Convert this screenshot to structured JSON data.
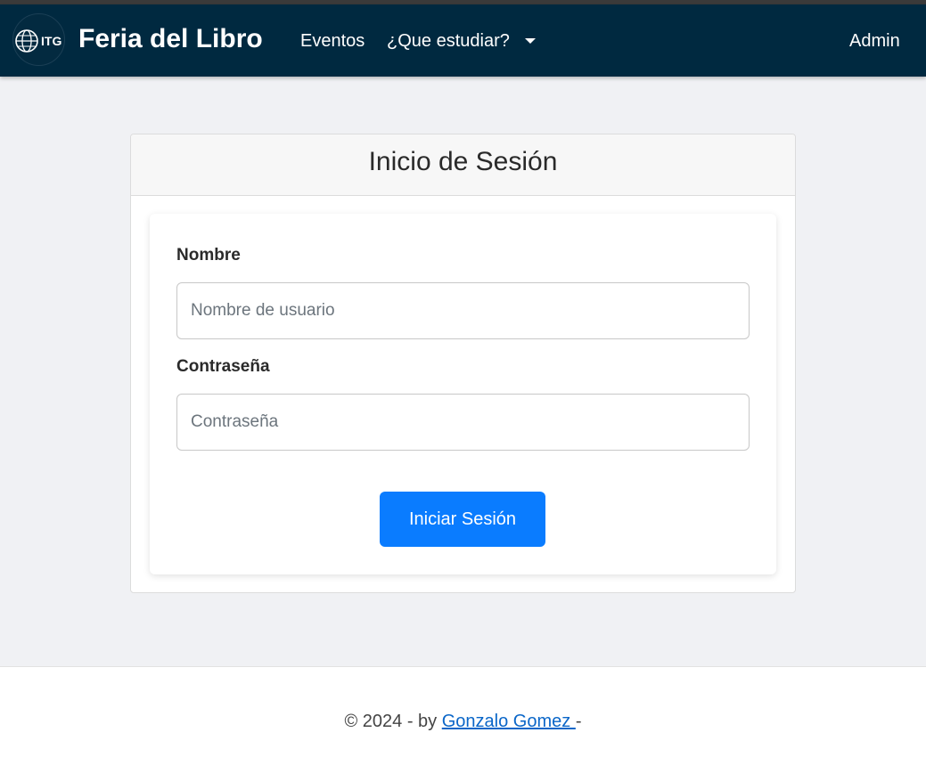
{
  "navbar": {
    "logo_text": "ITG",
    "brand": "Feria del Libro",
    "links": {
      "eventos": "Eventos",
      "estudiar": "¿Que estudiar?",
      "admin": "Admin"
    }
  },
  "login": {
    "title": "Inicio de Sesión",
    "username": {
      "label": "Nombre",
      "placeholder": "Nombre de usuario",
      "value": ""
    },
    "password": {
      "label": "Contraseña",
      "placeholder": "Contraseña",
      "value": ""
    },
    "submit_label": "Iniciar Sesión"
  },
  "footer": {
    "prefix": "© 2024 - by ",
    "author_link": "Gonzalo Gomez ",
    "suffix": "-"
  },
  "colors": {
    "navbar_bg": "#002940",
    "primary_button": "#0a7cff",
    "link": "#0a66c8"
  }
}
